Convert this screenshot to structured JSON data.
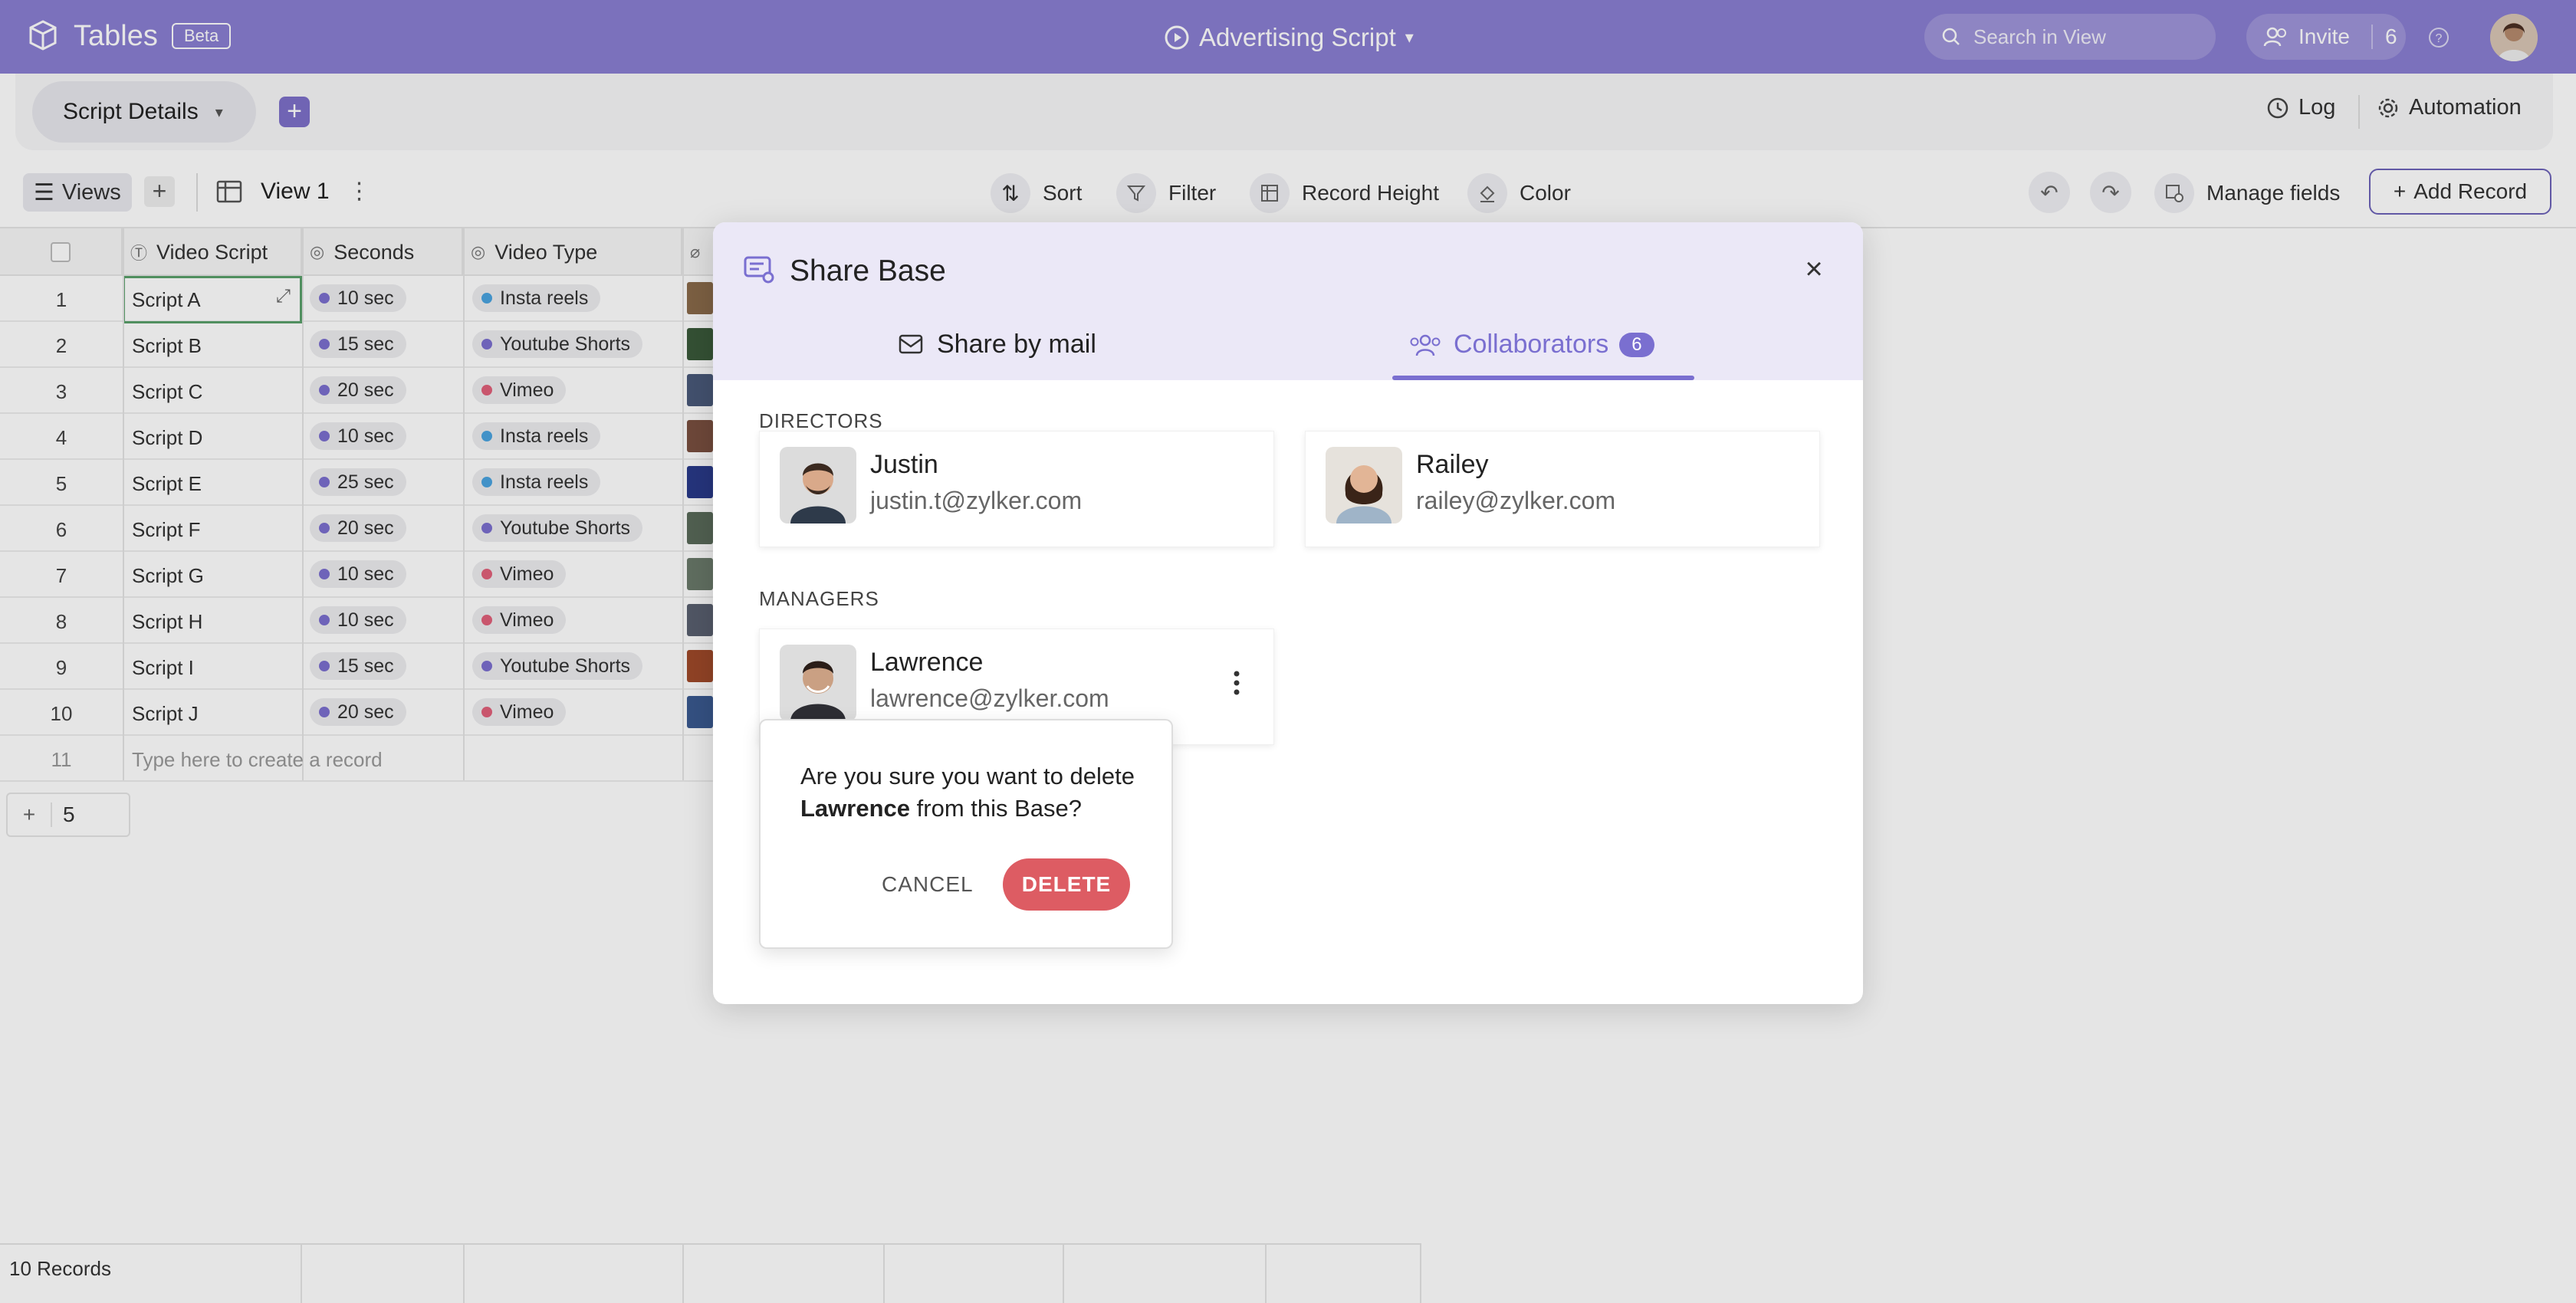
{
  "app": {
    "title": "Tables",
    "badge": "Beta",
    "doc_title": "Advertising Script"
  },
  "header": {
    "search_placeholder": "Search in View",
    "invite_label": "Invite",
    "invite_count": "6"
  },
  "subbar": {
    "tab_label": "Script Details",
    "log_label": "Log",
    "automation_label": "Automation"
  },
  "toolbar": {
    "views_label": "Views",
    "view_name": "View 1",
    "sort": "Sort",
    "filter": "Filter",
    "record_height": "Record Height",
    "color": "Color",
    "manage_fields": "Manage fields",
    "add_record": "Add Record"
  },
  "grid": {
    "columns": [
      "Video Script",
      "Seconds",
      "Video Type"
    ],
    "rows": [
      {
        "n": "1",
        "script": "Script A",
        "sec": "10 sec",
        "type": "Insta reels"
      },
      {
        "n": "2",
        "script": "Script B",
        "sec": "15 sec",
        "type": "Youtube Shorts"
      },
      {
        "n": "3",
        "script": "Script C",
        "sec": "20 sec",
        "type": "Vimeo"
      },
      {
        "n": "4",
        "script": "Script D",
        "sec": "10 sec",
        "type": "Insta reels"
      },
      {
        "n": "5",
        "script": "Script E",
        "sec": "25 sec",
        "type": "Insta reels"
      },
      {
        "n": "6",
        "script": "Script F",
        "sec": "20 sec",
        "type": "Youtube Shorts"
      },
      {
        "n": "7",
        "script": "Script G",
        "sec": "10 sec",
        "type": "Vimeo"
      },
      {
        "n": "8",
        "script": "Script H",
        "sec": "10 sec",
        "type": "Vimeo"
      },
      {
        "n": "9",
        "script": "Script I",
        "sec": "15 sec",
        "type": "Youtube Shorts"
      },
      {
        "n": "10",
        "script": "Script J",
        "sec": "20 sec",
        "type": "Vimeo"
      }
    ],
    "new_row_number": "11",
    "new_row_placeholder": "Type here to create a record",
    "add_rows_count": "5",
    "footer_records": "10 Records"
  },
  "colors": {
    "accent": "#8a7ed2",
    "sec_dot": "#7b6fcf",
    "reels_dot": "#4aa3df",
    "shorts_dot": "#7b6fcf",
    "vimeo_dot": "#e0607a",
    "delete": "#dd5c63"
  },
  "modal": {
    "title": "Share Base",
    "tab_mail": "Share by mail",
    "tab_collab": "Collaborators",
    "collab_count": "6",
    "directors_label": "DIRECTORS",
    "managers_label": "MANAGERS",
    "directors": [
      {
        "name": "Justin",
        "email": "justin.t@zylker.com"
      },
      {
        "name": "Railey",
        "email": "railey@zylker.com"
      }
    ],
    "managers": [
      {
        "name": "Lawrence",
        "email": "lawrence@zylker.com"
      }
    ]
  },
  "confirm": {
    "line1": "Are you sure you want to delete",
    "name": "Lawrence",
    "line2": "from this Base?",
    "cancel": "CANCEL",
    "delete": "DELETE"
  }
}
